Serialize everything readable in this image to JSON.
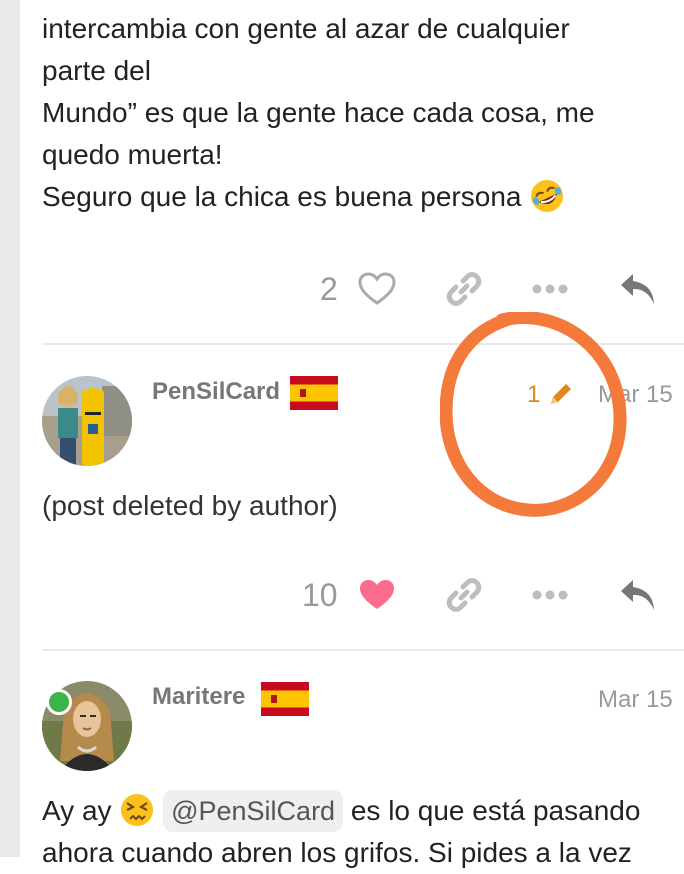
{
  "post_1": {
    "lines": [
      "intercambia con gente al azar de cualquier",
      "parte del",
      "Mundo” es que la gente hace cada cosa, me",
      "quedo muerta!",
      "Seguro que la chica es buena persona"
    ],
    "emoji": "rolling-on-floor-laughing",
    "like_count": "2",
    "liked": false
  },
  "post_2": {
    "username": "PenSilCard",
    "flag": "spain-flag",
    "edit_count": "1",
    "date": "Mar 15",
    "body": "(post deleted by author)",
    "like_count": "10",
    "liked": true
  },
  "post_3": {
    "username": "Maritere",
    "flag": "spain-flag",
    "date": "Mar 15",
    "online": true,
    "text_before": "Ay ay",
    "emoji": "persevering-face",
    "mention": "@PenSilCard",
    "text_after": "es lo que está pasando",
    "line2": "ahora cuando abren los grifos. Si pides a la vez"
  },
  "colors": {
    "accent_edit": "#e0881e",
    "like_active": "#fa6c8d",
    "annotation_circle": "#f47a3c",
    "online": "#3bb54a",
    "muted": "#999999"
  }
}
